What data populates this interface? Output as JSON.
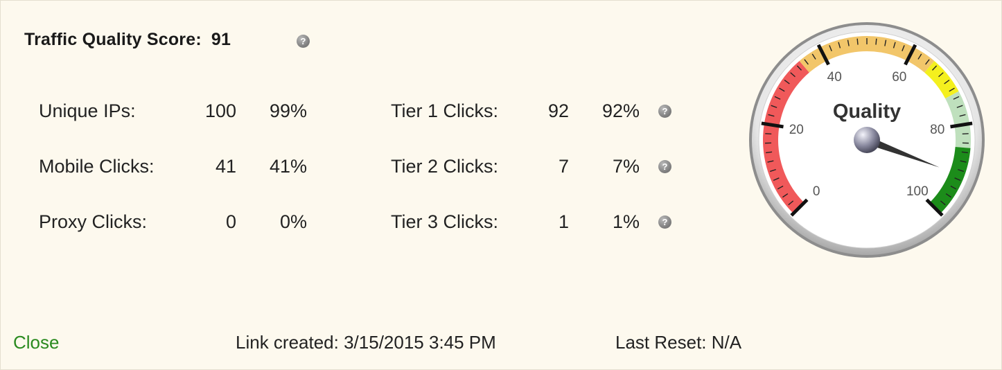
{
  "header": {
    "title": "Traffic Quality Score:",
    "score": "91"
  },
  "left_stats": [
    {
      "label": "Unique IPs:",
      "count": "100",
      "percent": "99%"
    },
    {
      "label": "Mobile Clicks:",
      "count": "41",
      "percent": "41%"
    },
    {
      "label": "Proxy Clicks:",
      "count": "0",
      "percent": "0%"
    }
  ],
  "right_stats": [
    {
      "label": "Tier 1 Clicks:",
      "count": "92",
      "percent": "92%"
    },
    {
      "label": "Tier 2 Clicks:",
      "count": "7",
      "percent": "7%"
    },
    {
      "label": "Tier 3 Clicks:",
      "count": "1",
      "percent": "1%"
    }
  ],
  "help_glyph": "?",
  "gauge": {
    "title": "Quality",
    "value": 91,
    "ticks": [
      "0",
      "20",
      "40",
      "60",
      "80",
      "100"
    ],
    "bands": [
      {
        "from": 0,
        "to": 35,
        "color": "#f0595a"
      },
      {
        "from": 35,
        "to": 65,
        "color": "#f2c66a"
      },
      {
        "from": 65,
        "to": 73,
        "color": "#f4f01e"
      },
      {
        "from": 73,
        "to": 85,
        "color": "#bfe0bd"
      },
      {
        "from": 85,
        "to": 100,
        "color": "#1c8c1a"
      }
    ]
  },
  "footer": {
    "close_label": "Close",
    "created": "Link created: 3/15/2015 3:45 PM",
    "last_reset": "Last Reset: N/A"
  },
  "colors": {
    "accent_green": "#2a8a1f",
    "background": "#fdf9ee"
  }
}
